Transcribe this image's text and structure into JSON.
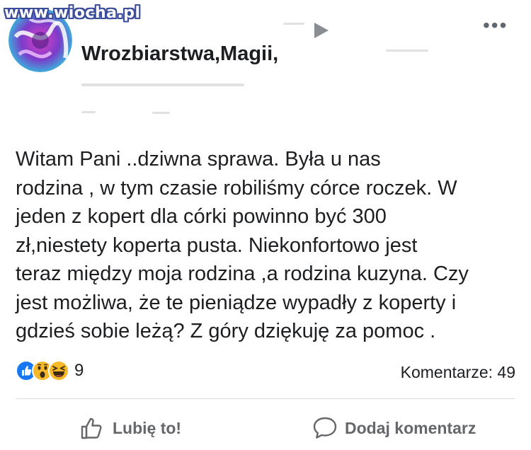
{
  "watermark": "www.wiocha.pl",
  "post": {
    "page_name": "Wrozbiarstwa,Magii,",
    "text": "Witam Pani                 ..dziwna sprawa. Była u nas\nrodzina , w tym czasie robiliśmy córce roczek. W\njeden z kopert dla córki powinno być 300\nzł,niestety koperta pusta. Niekonfortowo jest\nteraz między moja rodzina ,a rodzina kuzyna. Czy\njest możliwa, że te pieniądze wypadły z koperty i\ngdzieś sobie leżą?  Z góry dziękuję za pomoc ."
  },
  "reactions": {
    "icons": [
      "like-icon",
      "wow-icon",
      "haha-icon"
    ],
    "count": "9"
  },
  "comments_label": "Komentarze: 49",
  "actions": {
    "like_label": "Lubię to!",
    "comment_label": "Dodaj komentarz"
  },
  "colors": {
    "facebook_blue": "#1877f2",
    "reaction_yellow": "#f7b928",
    "action_gray": "#65676b"
  }
}
